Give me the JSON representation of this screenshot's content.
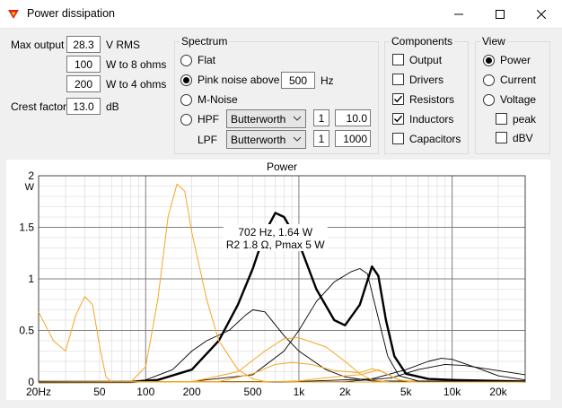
{
  "window": {
    "title": "Power dissipation"
  },
  "output": {
    "max_output_label": "Max output",
    "max_output_value": "28.3",
    "v_rms_label": "V  RMS",
    "w8_value": "100",
    "w8_label": "W to 8 ohms",
    "w4_value": "200",
    "w4_label": "W to 4 ohms",
    "crest_label": "Crest factor",
    "crest_value": "13.0",
    "crest_unit": "dB"
  },
  "spectrum": {
    "title": "Spectrum",
    "flat": "Flat",
    "pink": "Pink noise above",
    "pink_value": "500",
    "pink_unit": "Hz",
    "mnoise": "M-Noise",
    "hpf": "HPF",
    "hpf_type": "Butterworth",
    "hpf_order": "1",
    "hpf_freq": "10.0",
    "lpf": "LPF",
    "lpf_type": "Butterworth",
    "lpf_order": "1",
    "lpf_freq": "1000",
    "selected": "pink"
  },
  "components": {
    "title": "Components",
    "items": [
      {
        "label": "Output",
        "checked": false
      },
      {
        "label": "Drivers",
        "checked": false
      },
      {
        "label": "Resistors",
        "checked": true
      },
      {
        "label": "Inductors",
        "checked": true
      },
      {
        "label": "Capacitors",
        "checked": false
      }
    ]
  },
  "view": {
    "title": "View",
    "power": "Power",
    "current": "Current",
    "voltage": "Voltage",
    "peak": "peak",
    "dbv": "dBV",
    "selected": "power"
  },
  "chart_data": {
    "type": "line",
    "title": "Power",
    "ylabel": "W",
    "xscale": "log",
    "xlim": [
      20,
      30000
    ],
    "ylim": [
      0,
      2
    ],
    "x_ticks": [
      20,
      50,
      100,
      200,
      500,
      1000,
      2000,
      5000,
      10000,
      20000
    ],
    "x_tick_labels": [
      "20Hz",
      "50",
      "100",
      "200",
      "500",
      "1k",
      "2k",
      "5k",
      "10k",
      "20k"
    ],
    "y_ticks": [
      0,
      0.5,
      1,
      1.5,
      2
    ],
    "y_tick_labels": [
      "0",
      "0.5",
      "1",
      "1.5",
      "2"
    ],
    "annotation": {
      "line1": "702 Hz, 1.64 W",
      "line2": "R2 1.8 Ω, Pmax 5 W"
    },
    "colors": {
      "black": "#000000",
      "orange": "#f5a623",
      "grid_major": "#7f7f7f",
      "grid_minor": "#d6d6d6"
    },
    "series": [
      {
        "color": "#000000",
        "width": 2.4,
        "points": [
          [
            20,
            0
          ],
          [
            80,
            0.001
          ],
          [
            120,
            0.02
          ],
          [
            200,
            0.12
          ],
          [
            300,
            0.4
          ],
          [
            400,
            0.75
          ],
          [
            500,
            1.1
          ],
          [
            600,
            1.45
          ],
          [
            702,
            1.64
          ],
          [
            800,
            1.6
          ],
          [
            1000,
            1.35
          ],
          [
            1300,
            0.9
          ],
          [
            1700,
            0.6
          ],
          [
            2000,
            0.55
          ],
          [
            2500,
            0.75
          ],
          [
            3000,
            1.12
          ],
          [
            3300,
            1.03
          ],
          [
            3700,
            0.6
          ],
          [
            4200,
            0.25
          ],
          [
            5000,
            0.08
          ],
          [
            7000,
            0.03
          ],
          [
            10000,
            0.02
          ],
          [
            20000,
            0.01
          ],
          [
            30000,
            0.005
          ]
        ]
      },
      {
        "color": "#000000",
        "width": 0.9,
        "points": [
          [
            20,
            0
          ],
          [
            80,
            0.005
          ],
          [
            100,
            0.02
          ],
          [
            150,
            0.12
          ],
          [
            200,
            0.3
          ],
          [
            250,
            0.4
          ],
          [
            350,
            0.5
          ],
          [
            450,
            0.65
          ],
          [
            500,
            0.7
          ],
          [
            600,
            0.68
          ],
          [
            800,
            0.45
          ],
          [
            1000,
            0.3
          ],
          [
            1500,
            0.12
          ],
          [
            2000,
            0.05
          ],
          [
            3000,
            0.01
          ],
          [
            30000,
            0
          ]
        ]
      },
      {
        "color": "#000000",
        "width": 0.9,
        "points": [
          [
            20,
            0
          ],
          [
            200,
            0.005
          ],
          [
            500,
            0.07
          ],
          [
            800,
            0.3
          ],
          [
            1000,
            0.5
          ],
          [
            1300,
            0.78
          ],
          [
            1700,
            0.97
          ],
          [
            2200,
            1.07
          ],
          [
            2500,
            1.1
          ],
          [
            2800,
            1.05
          ],
          [
            3200,
            0.7
          ],
          [
            3800,
            0.25
          ],
          [
            4500,
            0.06
          ],
          [
            6000,
            0.01
          ],
          [
            30000,
            0
          ]
        ]
      },
      {
        "color": "#000000",
        "width": 0.9,
        "points": [
          [
            20,
            0
          ],
          [
            1000,
            0.005
          ],
          [
            3000,
            0.03
          ],
          [
            5000,
            0.12
          ],
          [
            7000,
            0.2
          ],
          [
            8500,
            0.23
          ],
          [
            10000,
            0.22
          ],
          [
            15000,
            0.13
          ],
          [
            20000,
            0.06
          ],
          [
            30000,
            0.02
          ]
        ]
      },
      {
        "color": "#000000",
        "width": 0.9,
        "points": [
          [
            20,
            0
          ],
          [
            2000,
            0.003
          ],
          [
            4000,
            0.04
          ],
          [
            6000,
            0.12
          ],
          [
            9000,
            0.17
          ],
          [
            12000,
            0.16
          ],
          [
            20000,
            0.11
          ],
          [
            30000,
            0.07
          ]
        ]
      },
      {
        "color": "#f5a623",
        "width": 1.0,
        "points": [
          [
            20,
            0.68
          ],
          [
            25,
            0.4
          ],
          [
            30,
            0.3
          ],
          [
            35,
            0.65
          ],
          [
            40,
            0.83
          ],
          [
            45,
            0.75
          ],
          [
            50,
            0.35
          ],
          [
            55,
            0.05
          ],
          [
            60,
            0
          ],
          [
            80,
            0
          ],
          [
            100,
            0.15
          ],
          [
            120,
            0.8
          ],
          [
            140,
            1.6
          ],
          [
            160,
            1.92
          ],
          [
            180,
            1.85
          ],
          [
            200,
            1.45
          ],
          [
            250,
            0.8
          ],
          [
            300,
            0.4
          ],
          [
            400,
            0.12
          ],
          [
            500,
            0.03
          ],
          [
            600,
            0.005
          ],
          [
            1000,
            0
          ],
          [
            30000,
            0
          ]
        ]
      },
      {
        "color": "#f5a623",
        "width": 1.0,
        "points": [
          [
            20,
            0
          ],
          [
            200,
            0.003
          ],
          [
            400,
            0.1
          ],
          [
            600,
            0.3
          ],
          [
            800,
            0.42
          ],
          [
            1000,
            0.43
          ],
          [
            1500,
            0.34
          ],
          [
            2000,
            0.2
          ],
          [
            2500,
            0.08
          ],
          [
            3000,
            0.02
          ],
          [
            4000,
            0
          ],
          [
            30000,
            0
          ]
        ]
      },
      {
        "color": "#f5a623",
        "width": 1.0,
        "points": [
          [
            20,
            0
          ],
          [
            300,
            0.005
          ],
          [
            500,
            0.08
          ],
          [
            700,
            0.17
          ],
          [
            900,
            0.19
          ],
          [
            1200,
            0.17
          ],
          [
            1700,
            0.11
          ],
          [
            2500,
            0.09
          ],
          [
            3000,
            0.13
          ],
          [
            3500,
            0.1
          ],
          [
            4500,
            0.02
          ],
          [
            6000,
            0
          ],
          [
            30000,
            0
          ]
        ]
      },
      {
        "color": "#f5a623",
        "width": 1.0,
        "points": [
          [
            20,
            0
          ],
          [
            600,
            0
          ],
          [
            1000,
            0.01
          ],
          [
            1500,
            0.04
          ],
          [
            2000,
            0.06
          ],
          [
            2500,
            0.07
          ],
          [
            3000,
            0.1
          ],
          [
            3300,
            0.12
          ],
          [
            3700,
            0.08
          ],
          [
            4500,
            0.02
          ],
          [
            6000,
            0
          ],
          [
            30000,
            0
          ]
        ]
      }
    ]
  }
}
